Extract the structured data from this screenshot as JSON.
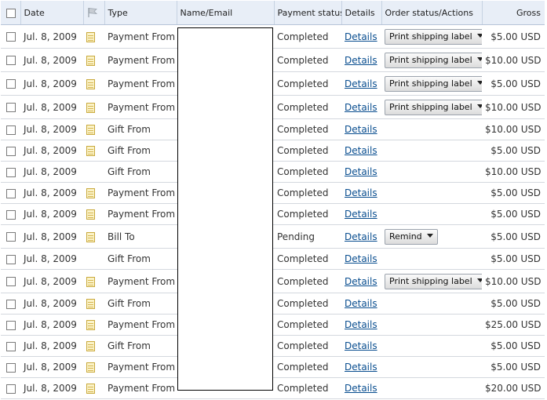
{
  "headers": {
    "date": "Date",
    "type": "Type",
    "name_email": "Name/Email",
    "payment_status": "Payment status",
    "details": "Details",
    "order_status": "Order status/Actions",
    "gross": "Gross"
  },
  "icons": {
    "note": "note-icon",
    "flag": "flag-icon"
  },
  "colors": {
    "header_bg": "#e8eef7",
    "link": "#084d8f"
  },
  "rows": [
    {
      "date": "Jul. 8, 2009",
      "note": true,
      "type": "Payment From",
      "status": "Completed",
      "details": "Details",
      "action": "Print shipping label",
      "gross": "$5.00 USD"
    },
    {
      "date": "Jul. 8, 2009",
      "note": true,
      "type": "Payment From",
      "status": "Completed",
      "details": "Details",
      "action": "Print shipping label",
      "gross": "$10.00 USD"
    },
    {
      "date": "Jul. 8, 2009",
      "note": true,
      "type": "Payment From",
      "status": "Completed",
      "details": "Details",
      "action": "Print shipping label",
      "gross": "$5.00 USD"
    },
    {
      "date": "Jul. 8, 2009",
      "note": true,
      "type": "Payment From",
      "status": "Completed",
      "details": "Details",
      "action": "Print shipping label",
      "gross": "$10.00 USD"
    },
    {
      "date": "Jul. 8, 2009",
      "note": true,
      "type": "Gift From",
      "status": "Completed",
      "details": "Details",
      "action": "",
      "gross": "$10.00 USD"
    },
    {
      "date": "Jul. 8, 2009",
      "note": true,
      "type": "Gift From",
      "status": "Completed",
      "details": "Details",
      "action": "",
      "gross": "$5.00 USD"
    },
    {
      "date": "Jul. 8, 2009",
      "note": false,
      "type": "Gift From",
      "status": "Completed",
      "details": "Details",
      "action": "",
      "gross": "$10.00 USD"
    },
    {
      "date": "Jul. 8, 2009",
      "note": true,
      "type": "Payment From",
      "status": "Completed",
      "details": "Details",
      "action": "",
      "gross": "$5.00 USD"
    },
    {
      "date": "Jul. 8, 2009",
      "note": true,
      "type": "Payment From",
      "status": "Completed",
      "details": "Details",
      "action": "",
      "gross": "$5.00 USD"
    },
    {
      "date": "Jul. 8, 2009",
      "note": true,
      "type": "Bill To",
      "status": "Pending",
      "details": "Details",
      "action": "Remind",
      "gross": "$5.00 USD"
    },
    {
      "date": "Jul. 8, 2009",
      "note": false,
      "type": "Gift From",
      "status": "Completed",
      "details": "Details",
      "action": "",
      "gross": "$5.00 USD"
    },
    {
      "date": "Jul. 8, 2009",
      "note": true,
      "type": "Payment From",
      "status": "Completed",
      "details": "Details",
      "action": "Print shipping label",
      "gross": "$10.00 USD"
    },
    {
      "date": "Jul. 8, 2009",
      "note": true,
      "type": "Gift From",
      "status": "Completed",
      "details": "Details",
      "action": "",
      "gross": "$5.00 USD"
    },
    {
      "date": "Jul. 8, 2009",
      "note": true,
      "type": "Payment From",
      "status": "Completed",
      "details": "Details",
      "action": "",
      "gross": "$25.00 USD"
    },
    {
      "date": "Jul. 8, 2009",
      "note": true,
      "type": "Gift From",
      "status": "Completed",
      "details": "Details",
      "action": "",
      "gross": "$5.00 USD"
    },
    {
      "date": "Jul. 8, 2009",
      "note": true,
      "type": "Payment From",
      "status": "Completed",
      "details": "Details",
      "action": "",
      "gross": "$5.00 USD"
    },
    {
      "date": "Jul. 8, 2009",
      "note": true,
      "type": "Payment From",
      "status": "Completed",
      "details": "Details",
      "action": "",
      "gross": "$20.00 USD"
    }
  ]
}
